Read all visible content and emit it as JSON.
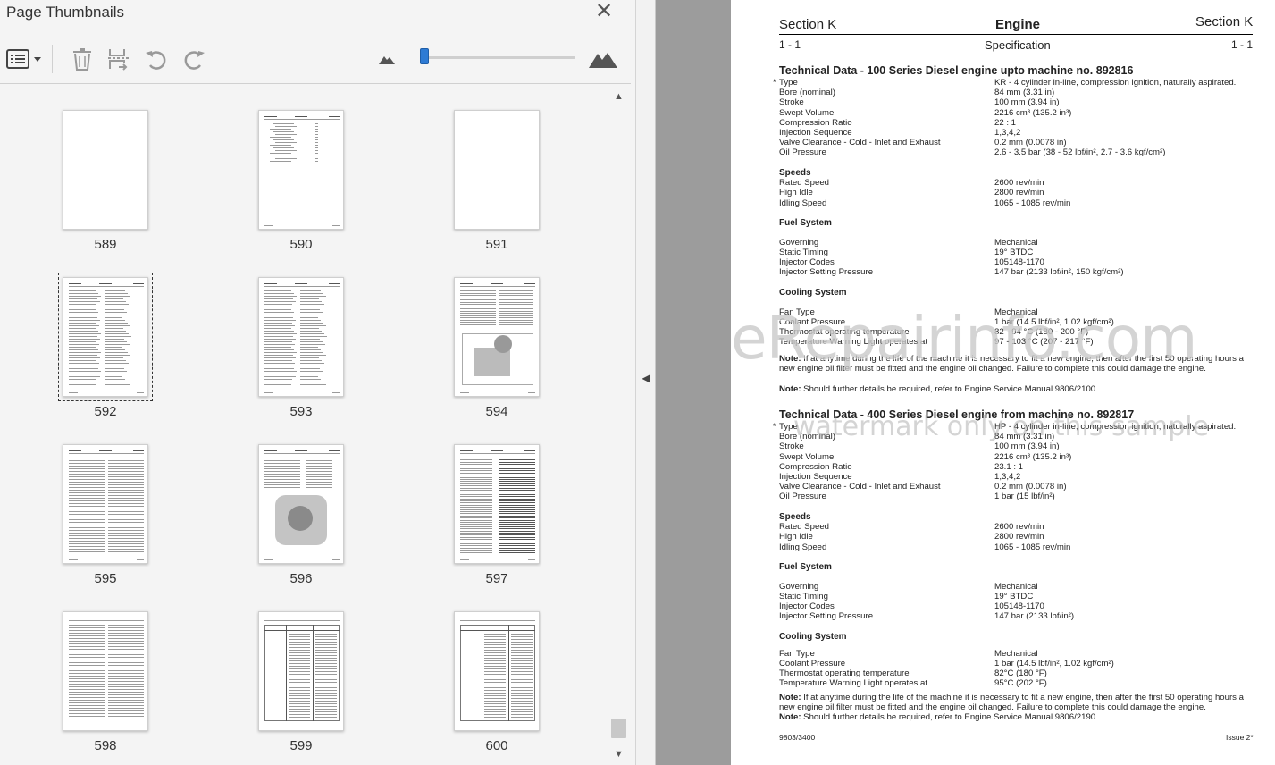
{
  "panel": {
    "title": "Page Thumbnails",
    "close_glyph": "✕",
    "toolbar": {
      "icons": [
        "thumbnail-options-icon",
        "delete-pages-icon",
        "extract-pages-icon",
        "undo-icon",
        "redo-icon",
        "zoom-out-mountain-icon",
        "zoom-in-mountain-icon"
      ],
      "zoom_slider_fraction": 0.0
    },
    "thumbnails": [
      {
        "page": "589"
      },
      {
        "page": "590"
      },
      {
        "page": "591"
      },
      {
        "page": "592"
      },
      {
        "page": "593"
      },
      {
        "page": "594"
      },
      {
        "page": "595"
      },
      {
        "page": "596"
      },
      {
        "page": "597"
      },
      {
        "page": "598"
      },
      {
        "page": "599"
      },
      {
        "page": "600"
      }
    ],
    "selected_page": "592",
    "scroll_up": "▲",
    "scroll_down": "▼"
  },
  "viewer": {
    "collapse_glyph": "◀"
  },
  "doc": {
    "header": {
      "section_left": "Section K",
      "title": "Engine",
      "section_right": "Section K",
      "page_left": "1 - 1",
      "subtitle": "Specification",
      "page_right": "1 - 1"
    },
    "part1": {
      "heading": "Technical Data - 100 Series Diesel engine upto machine no. 892816",
      "rows": [
        {
          "label": "Type",
          "value": "KR - 4 cylinder in-line, compression ignition, naturally aspirated."
        },
        {
          "label": "Bore (nominal)",
          "value": "84 mm (3.31 in)"
        },
        {
          "label": "Stroke",
          "value": "100 mm (3.94 in)"
        },
        {
          "label": "Swept Volume",
          "value": "2216 cm³ (135.2 in³)"
        },
        {
          "label": "Compression Ratio",
          "value": "22 : 1"
        },
        {
          "label": "Injection Sequence",
          "value": "1,3,4,2"
        },
        {
          "label": "Valve Clearance - Cold - Inlet and Exhaust",
          "value": "0.2 mm (0.0078 in)"
        },
        {
          "label": "Oil Pressure",
          "value": "2.6 - 3.5 bar (38 - 52 lbf/in², 2.7 - 3.6 kgf/cm²)"
        }
      ],
      "speeds_heading": "Speeds",
      "speeds": [
        {
          "label": "Rated Speed",
          "value": "2600 rev/min"
        },
        {
          "label": "High Idle",
          "value": "2800 rev/min"
        },
        {
          "label": "Idling Speed",
          "value": "1065 - 1085 rev/min"
        }
      ],
      "fuel_heading": "Fuel System",
      "fuel": [
        {
          "label": "Governing",
          "value": "Mechanical"
        },
        {
          "label": "Static Timing",
          "value": "19° BTDC"
        },
        {
          "label": "Injector Codes",
          "value": "105148-1170"
        },
        {
          "label": "Injector Setting Pressure",
          "value": "147 bar (2133 lbf/in², 150 kgf/cm²)"
        }
      ],
      "cooling_heading": "Cooling System",
      "cooling": [
        {
          "label": "Fan Type",
          "value": "Mechanical"
        },
        {
          "label": "Coolant Pressure",
          "value": "1 bar (14.5 lbf/in², 1.02 kgf/cm²)"
        },
        {
          "label": "Thermostat operating temperature",
          "value": "82 - 94 °C (180 - 200 °F)"
        },
        {
          "label": "Temperature Warning Light operates at",
          "value": "97 - 103 °C (207 - 217 °F)"
        }
      ],
      "note1_label": "Note:",
      "note1_text": " If at anytime during the life of the machine it is necessary to fit a new engine, then after the first 50 operating hours a new engine oil filter must be fitted and the engine oil changed. Failure to complete this could damage the engine.",
      "note2_label": "Note:",
      "note2_text": " Should further details be required, refer to Engine Service Manual 9806/2100."
    },
    "part2": {
      "heading": "Technical Data - 400 Series Diesel engine from machine no. 892817",
      "rows": [
        {
          "label": "Type",
          "value": "HP - 4 cylinder in-line, compression ignition, naturally aspirated."
        },
        {
          "label": "Bore (nominal)",
          "value": "84 mm (3.31 in)"
        },
        {
          "label": "Stroke",
          "value": "100 mm (3.94 in)"
        },
        {
          "label": "Swept Volume",
          "value": "2216 cm³ (135.2 in³)"
        },
        {
          "label": "Compression Ratio",
          "value": "23.1 : 1"
        },
        {
          "label": "Injection Sequence",
          "value": "1,3,4,2"
        },
        {
          "label": "Valve Clearance - Cold - Inlet and Exhaust",
          "value": "0.2 mm (0.0078 in)"
        },
        {
          "label": "Oil Pressure",
          "value": "1 bar (15 lbf/in²)"
        }
      ],
      "speeds_heading": "Speeds",
      "speeds": [
        {
          "label": "Rated Speed",
          "value": "2600 rev/min"
        },
        {
          "label": "High Idle",
          "value": "2800 rev/min"
        },
        {
          "label": "Idling Speed",
          "value": "1065 - 1085 rev/min"
        }
      ],
      "fuel_heading": "Fuel System",
      "fuel": [
        {
          "label": "Governing",
          "value": "Mechanical"
        },
        {
          "label": "Static Timing",
          "value": "19° BTDC"
        },
        {
          "label": "Injector Codes",
          "value": "105148-1170"
        },
        {
          "label": "Injector Setting Pressure",
          "value": "147 bar (2133 lbf/in²)"
        }
      ],
      "cooling_heading": "Cooling System",
      "cooling": [
        {
          "label": "Fan Type",
          "value": "Mechanical"
        },
        {
          "label": "Coolant Pressure",
          "value": "1 bar (14.5 lbf/in², 1.02 kgf/cm²)"
        },
        {
          "label": "Thermostat operating temperature",
          "value": "82°C (180 °F)"
        },
        {
          "label": "Temperature Warning Light operates at",
          "value": "95°C (202 °F)"
        }
      ],
      "note1_label": "Note:",
      "note1_text": " If at anytime during the life of the machine it is necessary to fit a new engine, then after the first 50 operating hours a new engine oil filter must be fitted and the engine oil changed. Failure to complete this could damage the engine.",
      "note2_label": "Note:",
      "note2_text": " Should further details be required, refer to Engine Service Manual 9806/2190."
    },
    "footer": {
      "left": "9803/3400",
      "right": "Issue 2*"
    },
    "watermark": {
      "line1": "eRepairinfo.com",
      "line2": "watermark only on this sample"
    }
  }
}
